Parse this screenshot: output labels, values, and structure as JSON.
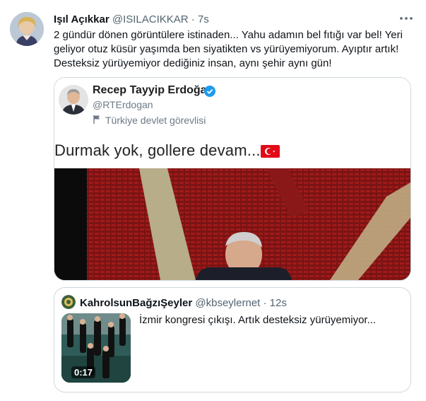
{
  "tweet": {
    "author_name": "Işıl Açıkkar",
    "author_handle": "@ISILACIKKAR",
    "separator": "·",
    "time": "7s",
    "text": "2 gündür dönen görüntülere istinaden... Yahu adamın bel fıtığı var bel! Yeri geliyor otuz küsür yaşımda ben siyatikten vs yürüyemiyorum. Ayıptır artık! Desteksiz yürüyemiyor dediğiniz insan, aynı şehir aynı gün!"
  },
  "embedded": {
    "name": "Recep Tayyip Erdoğan",
    "handle": "@RTErdogan",
    "role": "Türkiye devlet görevlisi",
    "text": "Durmak yok, gollere devam..."
  },
  "quoted": {
    "name": "KahrolsunBağzıŞeyler",
    "handle": "@kbseylernet",
    "separator": "·",
    "time": "12s",
    "text": "İzmir kongresi çıkışı. Artık desteksiz yürüyemiyor...",
    "duration": "0:17"
  },
  "icons": {
    "more": "more-horizontal-icon",
    "verified": "verified-badge-icon",
    "flag": "flag-icon"
  },
  "colors": {
    "verified": "#1d9bf0",
    "muted": "#536471",
    "turkey_flag": "#e30a17"
  }
}
